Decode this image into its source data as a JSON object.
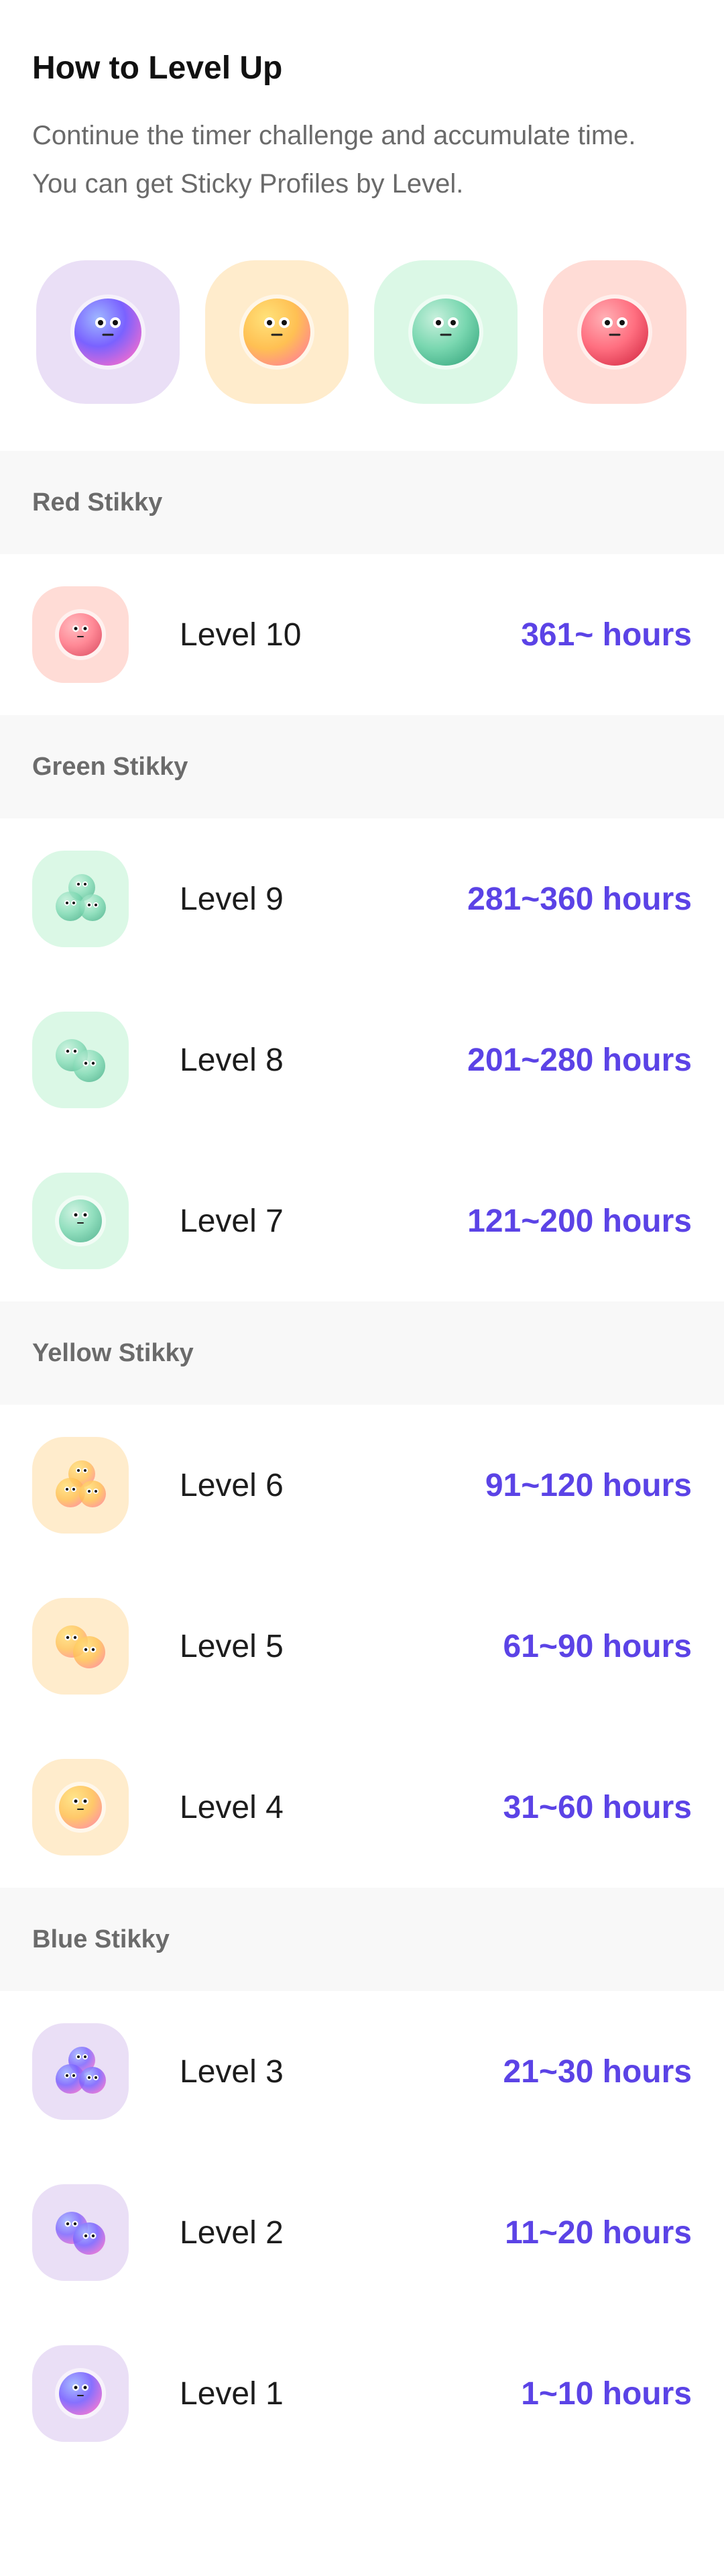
{
  "intro": {
    "title": "How to Level Up",
    "desc_line1": "Continue the timer challenge and accumulate time.",
    "desc_line2": "You can get Sticky Profiles by Level."
  },
  "colors": {
    "blue_tile": "#eadff6",
    "yellow_tile": "#ffeccc",
    "green_tile": "#dbf8e6",
    "red_tile": "#ffdcd6",
    "hours": "#5b43e6",
    "section_bg": "#f8f8f8"
  },
  "hero_icons": [
    "blue-stikky-icon",
    "yellow-stikky-icon",
    "green-stikky-icon",
    "red-stikky-icon"
  ],
  "sections": {
    "red": {
      "title": "Red Stikky",
      "levels": [
        {
          "label": "Level 10",
          "hours": "361~ hours"
        }
      ]
    },
    "green": {
      "title": "Green Stikky",
      "levels": [
        {
          "label": "Level 9",
          "hours": "281~360 hours"
        },
        {
          "label": "Level 8",
          "hours": "201~280 hours"
        },
        {
          "label": "Level 7",
          "hours": "121~200 hours"
        }
      ]
    },
    "yellow": {
      "title": "Yellow Stikky",
      "levels": [
        {
          "label": "Level 6",
          "hours": "91~120 hours"
        },
        {
          "label": "Level 5",
          "hours": "61~90 hours"
        },
        {
          "label": "Level 4",
          "hours": "31~60 hours"
        }
      ]
    },
    "blue": {
      "title": "Blue Stikky",
      "levels": [
        {
          "label": "Level 3",
          "hours": "21~30 hours"
        },
        {
          "label": "Level 2",
          "hours": "11~20 hours"
        },
        {
          "label": "Level 1",
          "hours": "1~10 hours"
        }
      ]
    }
  }
}
